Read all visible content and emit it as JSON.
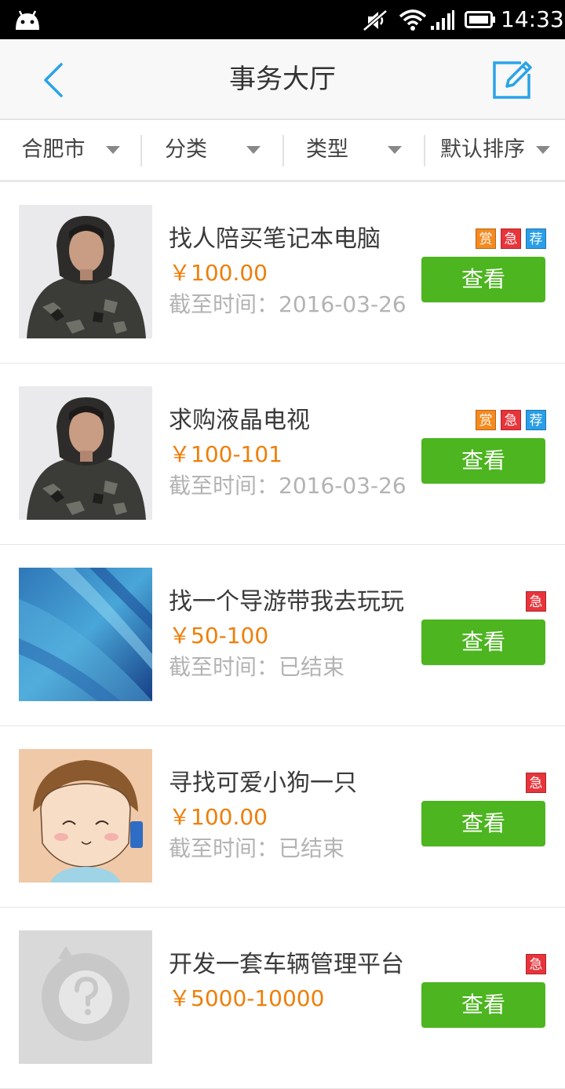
{
  "status_bar": {
    "time": "14:33",
    "icons": [
      "android-icon",
      "mute-icon",
      "wifi-icon",
      "signal-icon",
      "battery-icon"
    ]
  },
  "header": {
    "title": "事务大厅",
    "back_icon": "chevron-left-icon",
    "edit_icon": "edit-icon",
    "accent_color": "#29a3e8"
  },
  "filters": [
    {
      "label": "合肥市"
    },
    {
      "label": "分类"
    },
    {
      "label": "类型"
    },
    {
      "label": "默认排序"
    }
  ],
  "colors": {
    "price": "#ee7f0a",
    "button": "#4cb51f",
    "badge_reward": "#f58a1f",
    "badge_urgent": "#e8343b",
    "badge_recommend": "#2a9ee8"
  },
  "tasks": [
    {
      "title": "找人陪买笔记本电脑",
      "price": "￥100.00",
      "deadline": "截至时间：2016-03-26",
      "badges": [
        "赏",
        "急",
        "荐"
      ],
      "button": "查看",
      "image": "man-in-camo-jacket"
    },
    {
      "title": "求购液晶电视",
      "price": "￥100-101",
      "deadline": "截至时间：2016-03-26",
      "badges": [
        "赏",
        "急",
        "荐"
      ],
      "button": "查看",
      "image": "man-in-camo-jacket"
    },
    {
      "title": "找一个导游带我去玩玩",
      "price": "￥50-100",
      "deadline": "截至时间：已结束",
      "badges": [
        "急"
      ],
      "button": "查看",
      "image": "blue-abstract-wallpaper"
    },
    {
      "title": "寻找可爱小狗一只",
      "price": "￥100.00",
      "deadline": "截至时间：已结束",
      "badges": [
        "急"
      ],
      "button": "查看",
      "image": "cartoon-boy-drawing"
    },
    {
      "title": "开发一套车辆管理平台",
      "price": "￥5000-10000",
      "deadline": "",
      "badges": [
        "急"
      ],
      "button": "查看",
      "image": "placeholder-question"
    }
  ]
}
